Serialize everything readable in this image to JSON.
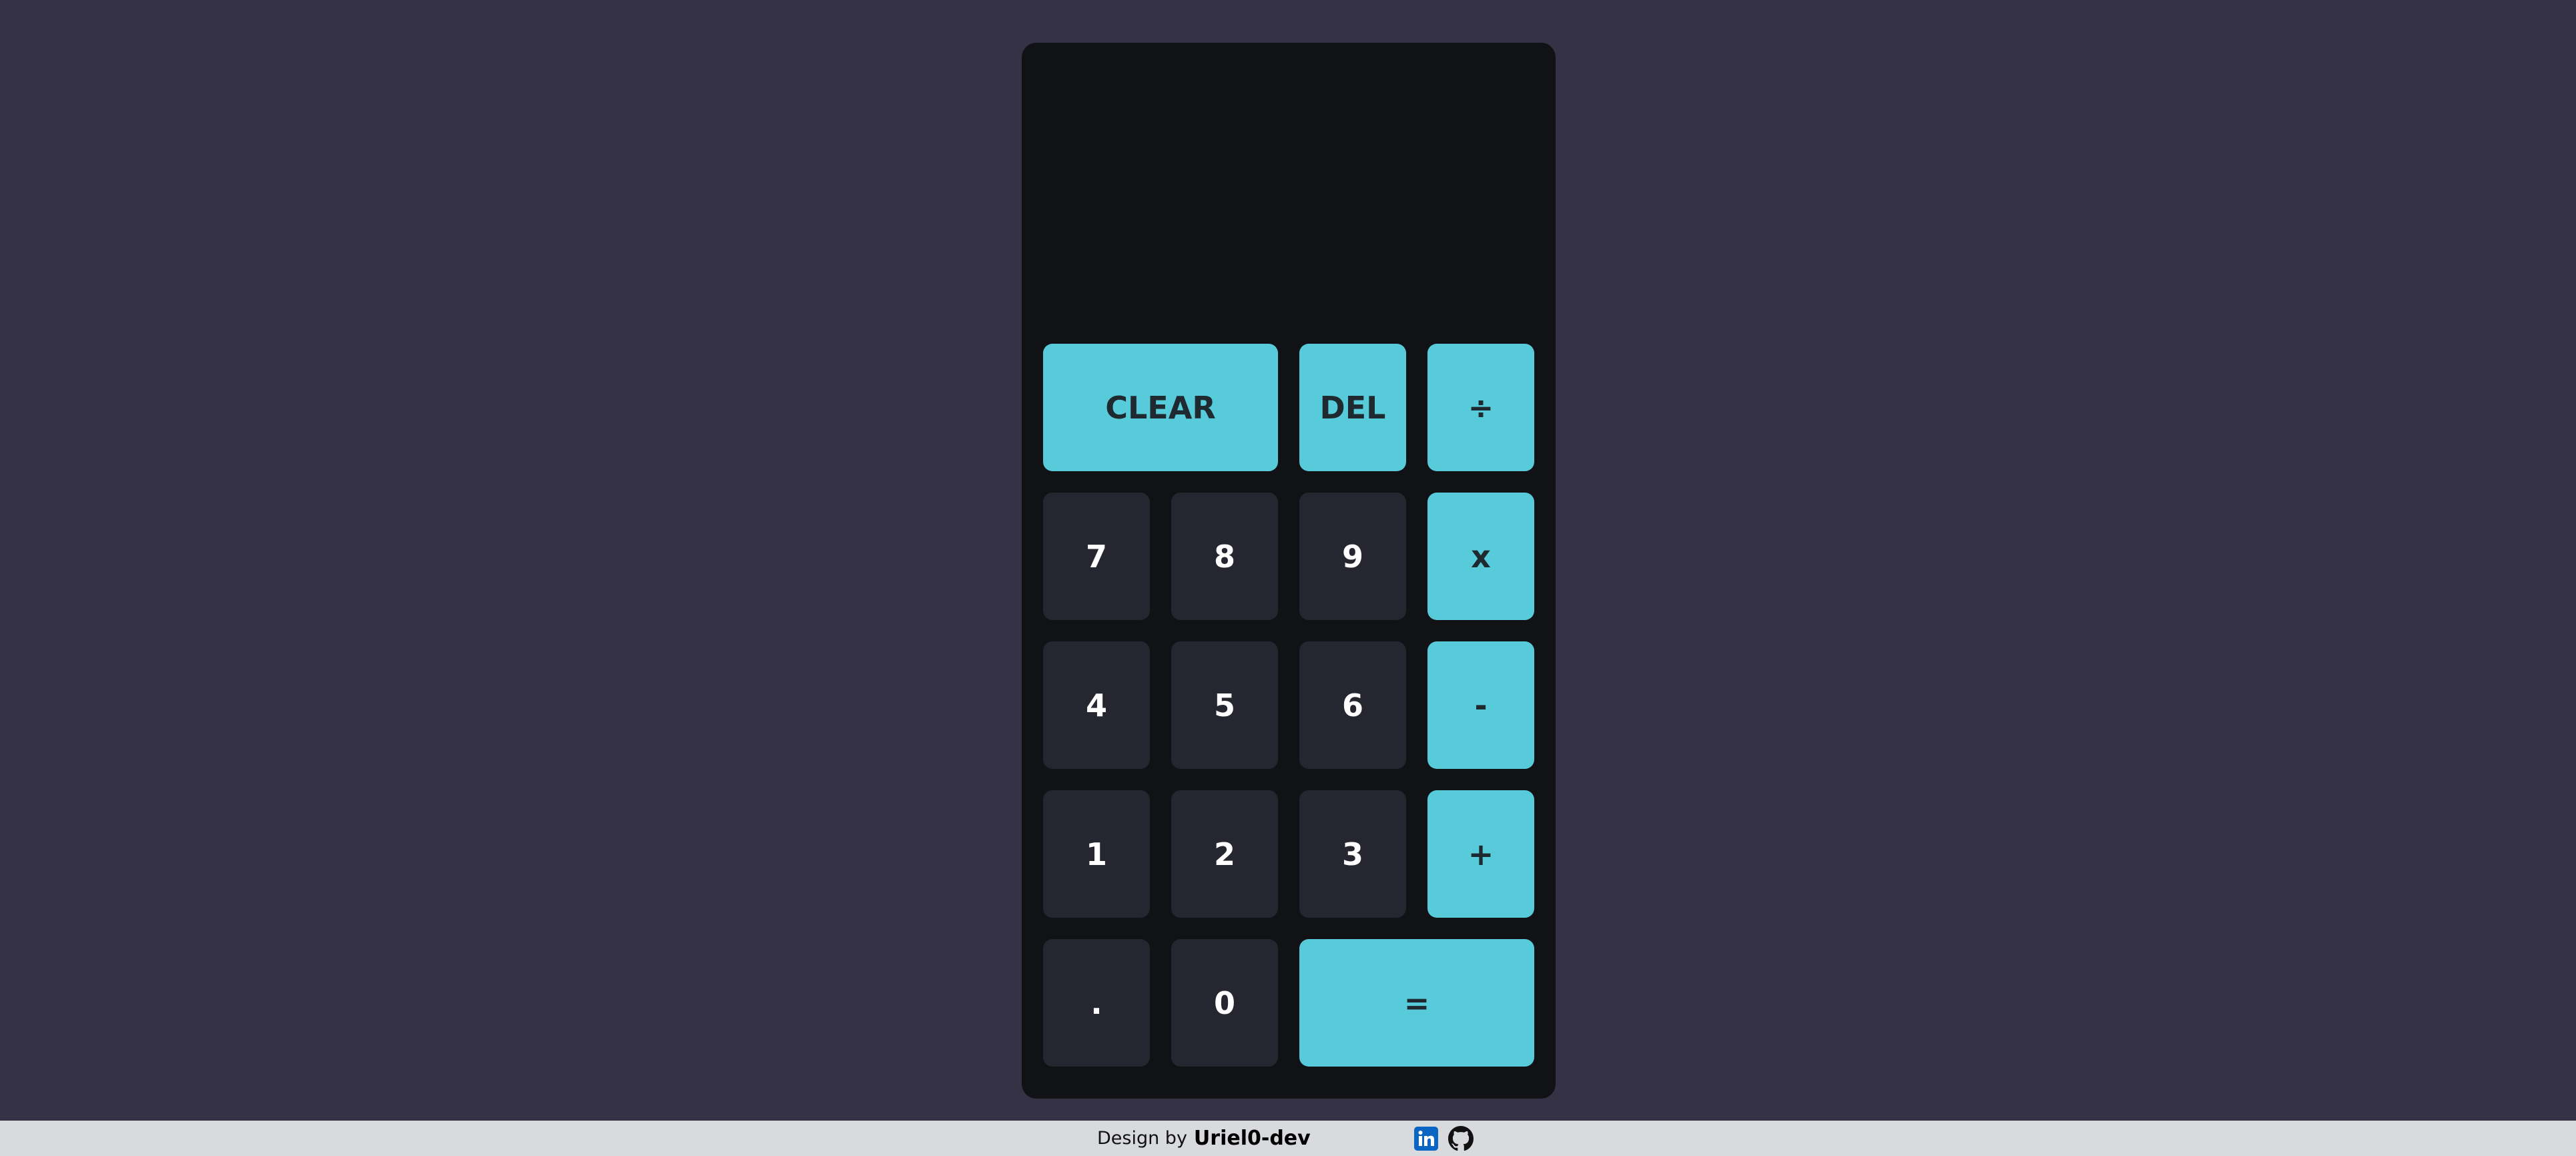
{
  "display": {
    "previous": "",
    "current": ""
  },
  "keys": {
    "clear": "CLEAR",
    "del": "DEL",
    "divide": "÷",
    "seven": "7",
    "eight": "8",
    "nine": "9",
    "multiply": "x",
    "four": "4",
    "five": "5",
    "six": "6",
    "minus": "-",
    "one": "1",
    "two": "2",
    "three": "3",
    "plus": "+",
    "dot": ".",
    "zero": "0",
    "equals": "="
  },
  "footer": {
    "prefix": "Design by",
    "author": "Uriel0-dev",
    "icons": [
      "linkedin-icon",
      "github-icon"
    ]
  },
  "colors": {
    "background": "#343244",
    "calculator_body": "#111216",
    "number_key": "#25262f",
    "operator_key": "#57cbd9",
    "operator_text": "#1f2a30",
    "footer_bg": "#d8dade",
    "linkedin": "#0a66c2"
  }
}
